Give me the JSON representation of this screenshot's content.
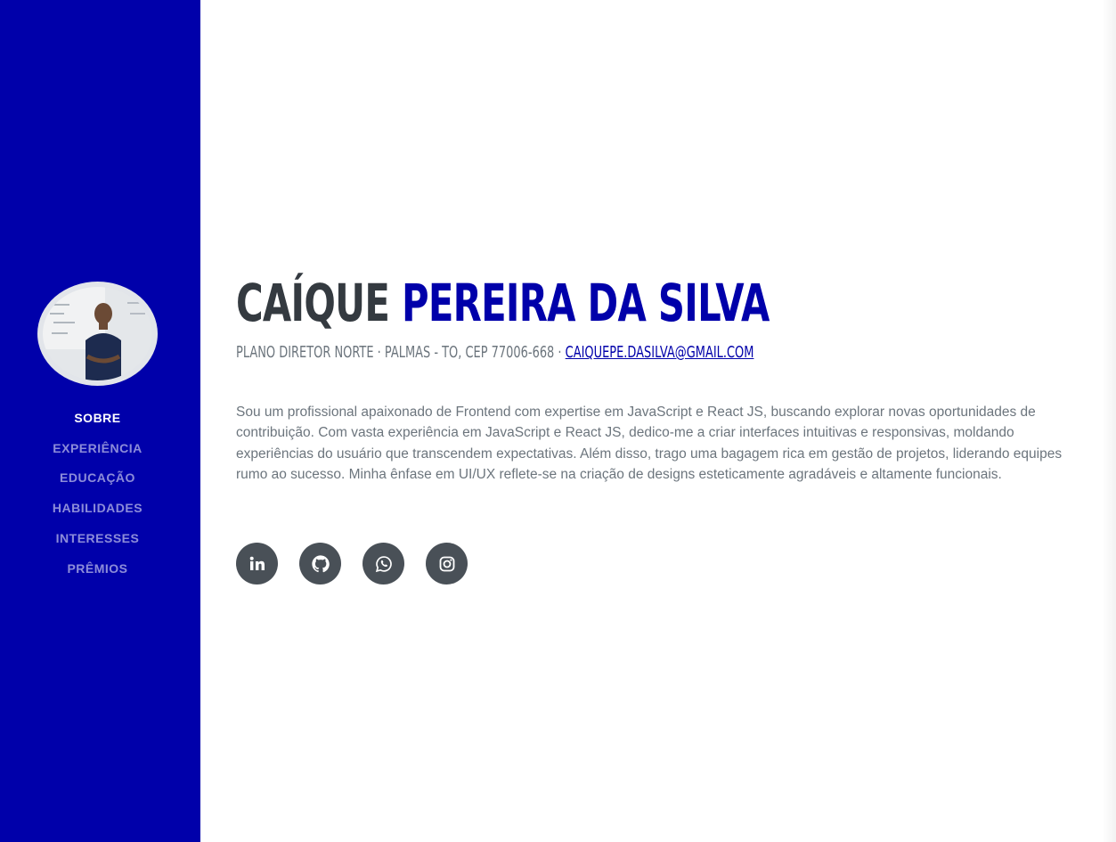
{
  "sidebar": {
    "avatar_alt": "",
    "nav": [
      {
        "label": "SOBRE",
        "active": true
      },
      {
        "label": "EXPERIÊNCIA",
        "active": false
      },
      {
        "label": "EDUCAÇÃO",
        "active": false
      },
      {
        "label": "HABILIDADES",
        "active": false
      },
      {
        "label": "INTERESSES",
        "active": false
      },
      {
        "label": "PRÊMIOS",
        "active": false
      }
    ]
  },
  "about": {
    "first_name": "CAÍQUE",
    "last_name": "PEREIRA DA SILVA",
    "address": "PLANO DIRETOR NORTE · PALMAS - TO, CEP 77006-668 ·",
    "email": "CAIQUEPE.DASILVA@GMAIL.COM",
    "bio": "Sou um profissional apaixonado de Frontend com expertise em JavaScript e React JS, buscando explorar novas oportunidades de contribuição. Com vasta experiência em JavaScript e React JS, dedico-me a criar interfaces intuitivas e responsivas, moldando experiências do usuário que transcendem expectativas. Além disso, trago uma bagagem rica em gestão de projetos, liderando equipes rumo ao sucesso. Minha ênfase em UI/UX reflete-se na criação de designs esteticamente agradáveis e altamente funcionais.",
    "social": [
      {
        "icon": "linkedin-icon"
      },
      {
        "icon": "github-icon"
      },
      {
        "icon": "whatsapp-icon"
      },
      {
        "icon": "instagram-icon"
      }
    ]
  },
  "colors": {
    "sidebar_bg": "#0000aa",
    "name_dark": "#343a40",
    "accent": "#0000aa",
    "text_muted": "#6c757d",
    "social_bg": "#495057"
  }
}
